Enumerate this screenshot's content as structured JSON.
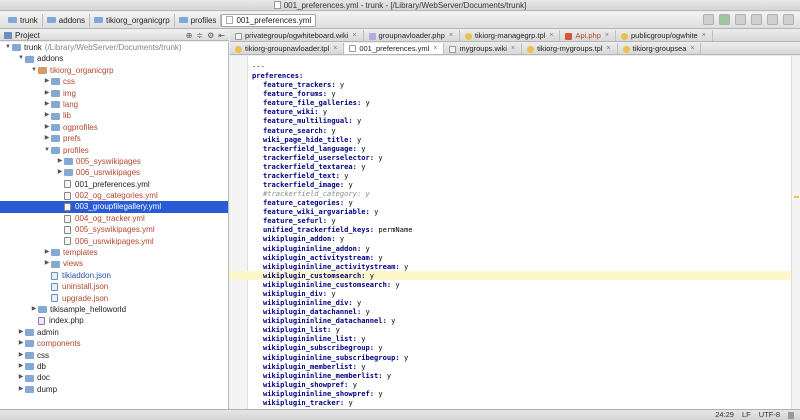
{
  "window": {
    "title": "001_preferences.yml - trunk - [/Library/WebServer/Documents/trunk]"
  },
  "breadcrumbs": [
    "trunk",
    "addons",
    "tikiorg_organicgrp",
    "profiles",
    "001_preferences.yml"
  ],
  "project_panel": {
    "header_label": "Project",
    "tools": [
      "⊕",
      "≑",
      "⚙",
      "⇤"
    ]
  },
  "tree": [
    {
      "depth": 0,
      "arrow": "▼",
      "icon": "folder",
      "label": "trunk",
      "suffix": "(/Library/WebServer/Documents/trunk)",
      "color": "default"
    },
    {
      "depth": 1,
      "arrow": "▼",
      "icon": "folder",
      "label": "addons",
      "color": "default"
    },
    {
      "depth": 2,
      "arrow": "▼",
      "icon": "folder-red",
      "label": "tikiorg_organicgrp",
      "color": "red"
    },
    {
      "depth": 3,
      "arrow": "▶",
      "icon": "folder",
      "label": "css",
      "color": "red"
    },
    {
      "depth": 3,
      "arrow": "▶",
      "icon": "folder",
      "label": "img",
      "color": "red"
    },
    {
      "depth": 3,
      "arrow": "▶",
      "icon": "folder",
      "label": "lang",
      "color": "red"
    },
    {
      "depth": 3,
      "arrow": "▶",
      "icon": "folder",
      "label": "lib",
      "color": "red"
    },
    {
      "depth": 3,
      "arrow": "▶",
      "icon": "folder",
      "label": "ogprofiles",
      "color": "red"
    },
    {
      "depth": 3,
      "arrow": "▶",
      "icon": "folder",
      "label": "prefs",
      "color": "red"
    },
    {
      "depth": 3,
      "arrow": "▼",
      "icon": "folder",
      "label": "profiles",
      "color": "red"
    },
    {
      "depth": 4,
      "arrow": "▶",
      "icon": "folder",
      "label": "005_syswikipages",
      "color": "red"
    },
    {
      "depth": 4,
      "arrow": "▶",
      "icon": "folder",
      "label": "006_usrwikipages",
      "color": "red"
    },
    {
      "depth": 4,
      "arrow": "",
      "icon": "yml",
      "label": "001_preferences.yml",
      "color": "default"
    },
    {
      "depth": 4,
      "arrow": "",
      "icon": "yml",
      "label": "002_og_categories.yml",
      "color": "red"
    },
    {
      "depth": 4,
      "arrow": "",
      "icon": "yml",
      "label": "003_groupfilegallery.yml",
      "color": "red",
      "selected": true
    },
    {
      "depth": 4,
      "arrow": "",
      "icon": "yml",
      "label": "004_og_tracker.yml",
      "color": "red"
    },
    {
      "depth": 4,
      "arrow": "",
      "icon": "yml",
      "label": "005_syswikipages.yml",
      "color": "red"
    },
    {
      "depth": 4,
      "arrow": "",
      "icon": "yml",
      "label": "006_usrwikipages.yml",
      "color": "red"
    },
    {
      "depth": 3,
      "arrow": "▶",
      "icon": "folder",
      "label": "templates",
      "color": "red"
    },
    {
      "depth": 3,
      "arrow": "▶",
      "icon": "folder",
      "label": "views",
      "color": "red"
    },
    {
      "depth": 3,
      "arrow": "",
      "icon": "json",
      "label": "tikiaddon.json",
      "color": "blue"
    },
    {
      "depth": 3,
      "arrow": "",
      "icon": "json",
      "label": "uninstall.json",
      "color": "red"
    },
    {
      "depth": 3,
      "arrow": "",
      "icon": "json",
      "label": "upgrade.json",
      "color": "red"
    },
    {
      "depth": 2,
      "arrow": "▶",
      "icon": "folder",
      "label": "tikisample_helloworld",
      "color": "default"
    },
    {
      "depth": 2,
      "arrow": "",
      "icon": "php",
      "label": "index.php",
      "color": "default"
    },
    {
      "depth": 1,
      "arrow": "▶",
      "icon": "folder",
      "label": "admin",
      "color": "default"
    },
    {
      "depth": 1,
      "arrow": "▶",
      "icon": "folder",
      "label": "components",
      "color": "red"
    },
    {
      "depth": 1,
      "arrow": "▶",
      "icon": "folder",
      "label": "css",
      "color": "default"
    },
    {
      "depth": 1,
      "arrow": "▶",
      "icon": "folder",
      "label": "db",
      "color": "default"
    },
    {
      "depth": 1,
      "arrow": "▶",
      "icon": "folder",
      "label": "doc",
      "color": "default"
    },
    {
      "depth": 1,
      "arrow": "▶",
      "icon": "folder",
      "label": "dump",
      "color": "default"
    }
  ],
  "tabs_row1": [
    {
      "label": "privategroup/ogwhiteboard.wiki",
      "type": "wiki"
    },
    {
      "label": "groupnavloader.php",
      "type": "php"
    },
    {
      "label": "tikiorg-managegrp.tpl",
      "type": "tpl"
    },
    {
      "label": "Api.php",
      "type": "red",
      "red": true
    },
    {
      "label": "publicgroup/ogwhite",
      "type": "tpl"
    }
  ],
  "tabs_row2": [
    {
      "label": "tikiorg-groupnavloader.tpl",
      "type": "tpl"
    },
    {
      "label": "001_preferences.yml",
      "type": "yml",
      "active": true
    },
    {
      "label": "mygroups.wiki",
      "type": "wiki"
    },
    {
      "label": "tikiorg-mygroups.tpl",
      "type": "tpl"
    },
    {
      "label": "tikiorg-groupsea",
      "type": "tpl"
    }
  ],
  "editor": {
    "lines": [
      {
        "text": "---",
        "indent": 0
      },
      {
        "key": "preferences:",
        "value": "",
        "indent": 0
      },
      {
        "key": "feature_trackers:",
        "value": "y",
        "indent": 1
      },
      {
        "key": "feature_forums:",
        "value": "y",
        "indent": 1
      },
      {
        "key": "feature_file_galleries:",
        "value": "y",
        "indent": 1
      },
      {
        "key": "feature_wiki:",
        "value": "y",
        "indent": 1
      },
      {
        "key": "feature_multilingual:",
        "value": "y",
        "indent": 1
      },
      {
        "key": "feature_search:",
        "value": "y",
        "indent": 1
      },
      {
        "key": "wiki_page_hide_title:",
        "value": "y",
        "indent": 1
      },
      {
        "key": "trackerfield_language:",
        "value": "y",
        "indent": 1
      },
      {
        "key": "trackerfield_userselector:",
        "value": "y",
        "indent": 1
      },
      {
        "key": "trackerfield_textarea:",
        "value": "y",
        "indent": 1
      },
      {
        "key": "trackerfield_text:",
        "value": "y",
        "indent": 1
      },
      {
        "key": "trackerfield_image:",
        "value": "y",
        "indent": 1
      },
      {
        "comment": "#trackerfield_category: y",
        "indent": 1
      },
      {
        "key": "feature_categories:",
        "value": "y",
        "indent": 1
      },
      {
        "key": "feature_wiki_argvariable:",
        "value": "y",
        "indent": 1
      },
      {
        "key": "feature_sefurl:",
        "value": "y",
        "indent": 1
      },
      {
        "key": "unified_trackerfield_keys:",
        "value": "permName",
        "indent": 1
      },
      {
        "key": "wikiplugin_addon:",
        "value": "y",
        "indent": 1
      },
      {
        "key": "wikiplugininline_addon:",
        "value": "y",
        "indent": 1
      },
      {
        "key": "wikiplugin_activitystream:",
        "value": "y",
        "indent": 1
      },
      {
        "key": "wikiplugininline_activitystream:",
        "value": "y",
        "indent": 1
      },
      {
        "key": "wikiplugin_customsearch:",
        "value": "y",
        "indent": 1,
        "highlight": true
      },
      {
        "key": "wikiplugininline_customsearch:",
        "value": "y",
        "indent": 1
      },
      {
        "key": "wikiplugin_div:",
        "value": "y",
        "indent": 1
      },
      {
        "key": "wikiplugininline_div:",
        "value": "y",
        "indent": 1
      },
      {
        "key": "wikiplugin_datachannel:",
        "value": "y",
        "indent": 1
      },
      {
        "key": "wikiplugininline_datachannel:",
        "value": "y",
        "indent": 1
      },
      {
        "key": "wikiplugin_list:",
        "value": "y",
        "indent": 1
      },
      {
        "key": "wikiplugininline_list:",
        "value": "y",
        "indent": 1
      },
      {
        "key": "wikiplugin_subscribegroup:",
        "value": "y",
        "indent": 1
      },
      {
        "key": "wikiplugininline_subscribegroup:",
        "value": "y",
        "indent": 1
      },
      {
        "key": "wikiplugin_memberlist:",
        "value": "y",
        "indent": 1
      },
      {
        "key": "wikiplugininline_memberlist:",
        "value": "y",
        "indent": 1
      },
      {
        "key": "wikiplugin_showpref:",
        "value": "y",
        "indent": 1
      },
      {
        "key": "wikiplugininline_showpref:",
        "value": "y",
        "indent": 1
      },
      {
        "key": "wikiplugin_tracker:",
        "value": "y",
        "indent": 1
      }
    ]
  },
  "status": {
    "position": "24:29",
    "line_sep": "LF",
    "encoding": "UTF-8"
  }
}
